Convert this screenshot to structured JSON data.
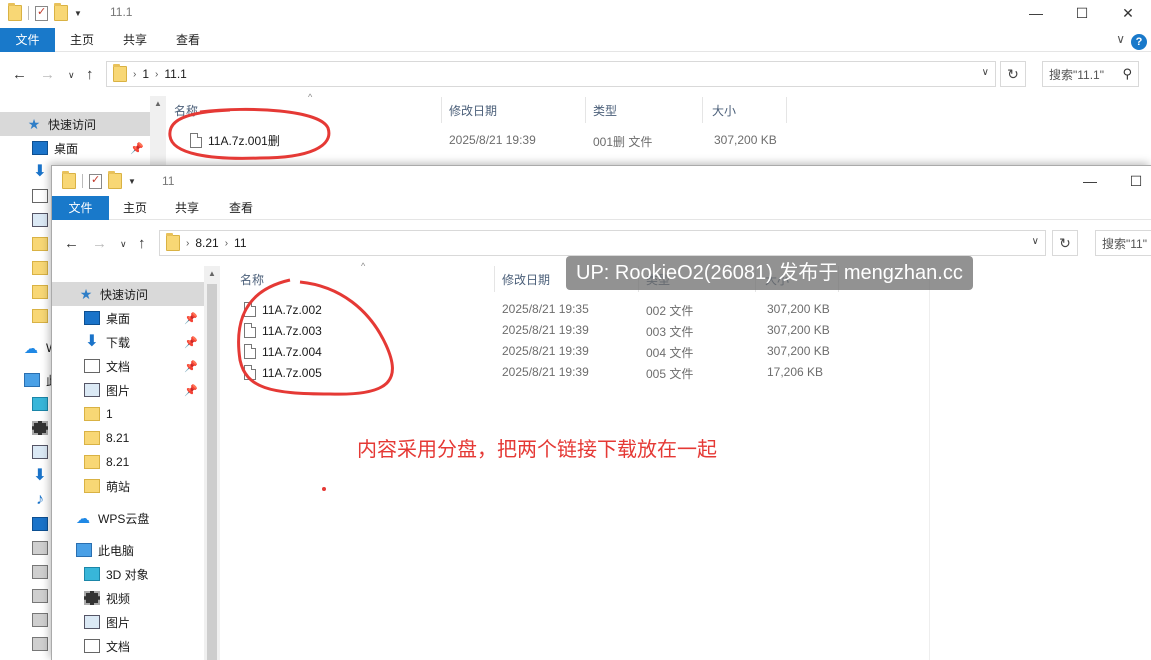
{
  "back_window": {
    "title": "11.1",
    "ribbon_tabs": [
      "文件",
      "主页",
      "共享",
      "查看"
    ],
    "breadcrumb": [
      "1",
      "11.1"
    ],
    "search_placeholder": "搜索\"11.1\"",
    "columns": {
      "name": "名称",
      "modified": "修改日期",
      "type": "类型",
      "size": "大小"
    },
    "files": [
      {
        "name": "11A.7z.001删",
        "modified": "2025/8/21 19:39",
        "type": "001删 文件",
        "size": "307,200 KB"
      }
    ],
    "nav_items": [
      {
        "label": "快速访问",
        "icon": "star-icon"
      },
      {
        "label": "桌面",
        "icon": "desktop-icon"
      },
      {
        "label": "W",
        "icon": "cloud-icon"
      },
      {
        "label": "此",
        "icon": "pc-icon"
      }
    ]
  },
  "front_window": {
    "title": "11",
    "ribbon_tabs": [
      "文件",
      "主页",
      "共享",
      "查看"
    ],
    "breadcrumb": [
      "8.21",
      "11"
    ],
    "search_placeholder": "搜索\"11\"",
    "columns": {
      "name": "名称",
      "modified": "修改日期",
      "type": "类型",
      "size": "大小"
    },
    "files": [
      {
        "name": "11A.7z.002",
        "modified": "2025/8/21 19:35",
        "type": "002 文件",
        "size": "307,200 KB"
      },
      {
        "name": "11A.7z.003",
        "modified": "2025/8/21 19:39",
        "type": "003 文件",
        "size": "307,200 KB"
      },
      {
        "name": "11A.7z.004",
        "modified": "2025/8/21 19:39",
        "type": "004 文件",
        "size": "307,200 KB"
      },
      {
        "name": "11A.7z.005",
        "modified": "2025/8/21 19:39",
        "type": "005 文件",
        "size": "17,206 KB"
      }
    ],
    "nav_items": [
      {
        "label": "快速访问",
        "icon": "star-icon",
        "pinned": false
      },
      {
        "label": "桌面",
        "icon": "desktop-icon",
        "pinned": true
      },
      {
        "label": "下载",
        "icon": "download-icon",
        "pinned": true
      },
      {
        "label": "文档",
        "icon": "document-icon",
        "pinned": true
      },
      {
        "label": "图片",
        "icon": "picture-icon",
        "pinned": true
      },
      {
        "label": "1",
        "icon": "folder-icon",
        "pinned": false
      },
      {
        "label": "8.21",
        "icon": "folder-icon",
        "pinned": false
      },
      {
        "label": "8.21",
        "icon": "folder-icon",
        "pinned": false
      },
      {
        "label": "萌站",
        "icon": "folder-icon",
        "pinned": false
      },
      {
        "label": "WPS云盘",
        "icon": "cloud-icon",
        "pinned": false
      },
      {
        "label": "此电脑",
        "icon": "pc-icon",
        "pinned": false
      },
      {
        "label": "3D 对象",
        "icon": "3d-objects-icon",
        "pinned": false
      },
      {
        "label": "视频",
        "icon": "video-icon",
        "pinned": false
      },
      {
        "label": "图片",
        "icon": "picture-icon",
        "pinned": false
      },
      {
        "label": "文档",
        "icon": "document-icon",
        "pinned": false
      }
    ]
  },
  "watermark": "UP: RookieO2(26081) 发布于 mengzhan.cc",
  "annotation_note": "内容采用分盘，把两个链接下载放在一起",
  "colors": {
    "ribbon_file_tab": "#1979ca",
    "annotation_red": "#e53935",
    "selected_nav": "#d9d9d9"
  }
}
